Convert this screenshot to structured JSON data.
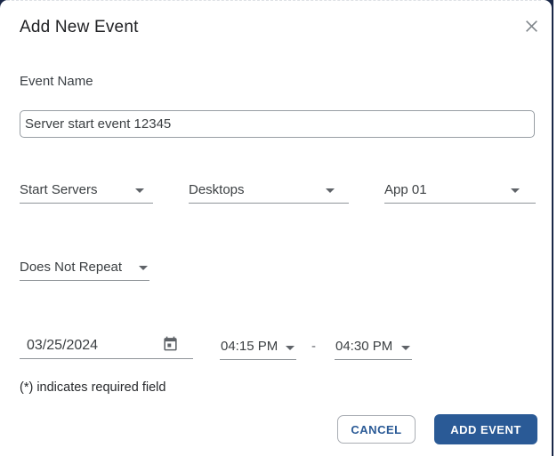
{
  "dialog": {
    "title": "Add New Event"
  },
  "form": {
    "event_name": {
      "label": "Event Name",
      "value": "Server start event 12345"
    },
    "dropdowns": {
      "event_type": "Start Servers",
      "resource_type": "Desktops",
      "resource": "App 01",
      "repeat": "Does Not Repeat"
    },
    "schedule": {
      "date": "03/25/2024",
      "start_time": "04:15 PM",
      "separator": "-",
      "end_time": "04:30 PM"
    },
    "required_note": "(*) indicates required field"
  },
  "actions": {
    "cancel_label": "CANCEL",
    "submit_label": "ADD EVENT"
  },
  "icons": {
    "close": "close-icon",
    "calendar": "calendar-icon",
    "caret": "chevron-down-icon"
  },
  "colors": {
    "primary_blue": "#2a5a96",
    "backdrop_navy": "#192747",
    "underline_gray": "#8f9499",
    "text_dark": "#202124",
    "text_gray": "#3c4043"
  }
}
